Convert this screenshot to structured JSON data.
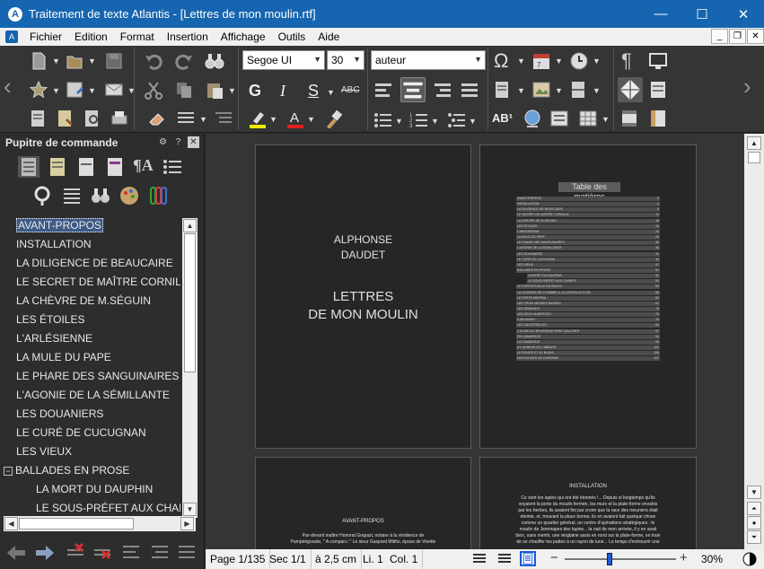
{
  "window": {
    "title": "Traitement de texte Atlantis - [Lettres de mon moulin.rtf]",
    "app_icon": "A",
    "minimize": "—",
    "maximize": "☐",
    "close": "✕"
  },
  "menu": {
    "items": [
      "Fichier",
      "Edition",
      "Format",
      "Insertion",
      "Affichage",
      "Outils",
      "Aide"
    ],
    "mdi_minimize": "_",
    "mdi_restore": "❐",
    "mdi_close": "✕"
  },
  "toolbar": {
    "font_name": "Segoe UI",
    "font_size": "30",
    "style_name": "auteur",
    "bold": "G",
    "italic": "I",
    "underline": "S",
    "strike": "ABC",
    "superscript_label": "AB¹"
  },
  "panel": {
    "title": "Pupitre de commande",
    "gear": "⚙",
    "help": "?",
    "close": "✕",
    "tree": [
      {
        "label": "AVANT-PROPOS",
        "selected": true,
        "indent": 0
      },
      {
        "label": "INSTALLATION",
        "indent": 0
      },
      {
        "label": "LA DILIGENCE DE BEAUCAIRE",
        "indent": 0
      },
      {
        "label": "LE SECRET DE MAÎTRE CORNILLE",
        "indent": 0
      },
      {
        "label": "LA CHÈVRE DE M.SÉGUIN",
        "indent": 0
      },
      {
        "label": "LES ÉTOILES",
        "indent": 0
      },
      {
        "label": "L'ARLÉSIENNE",
        "indent": 0
      },
      {
        "label": "LA MULE DU PAPE",
        "indent": 0
      },
      {
        "label": "LE PHARE DES SANGUINAIRES",
        "indent": 0
      },
      {
        "label": "L'AGONIE DE LA SÉMILLANTE",
        "indent": 0
      },
      {
        "label": "LES DOUANIERS",
        "indent": 0
      },
      {
        "label": "LE CURÉ DE CUCUGNAN",
        "indent": 0
      },
      {
        "label": "LES VIEUX",
        "indent": 0
      },
      {
        "label": "BALLADES EN PROSE",
        "indent": 0,
        "toggle": "−"
      },
      {
        "label": "LA MORT DU DAUPHIN",
        "indent": 1
      },
      {
        "label": "LE SOUS-PRÉFET AUX CHAMPS",
        "indent": 1
      }
    ]
  },
  "document": {
    "cover": {
      "author_line1": "ALPHONSE",
      "author_line2": "DAUDET",
      "title_line1": "LETTRES",
      "title_line2": "DE MON MOULIN"
    },
    "toc": {
      "title": "Table des matières",
      "entries": [
        {
          "t": "AVANT-PROPOS",
          "p": "3"
        },
        {
          "t": "INSTALLATION",
          "p": "4"
        },
        {
          "t": "LA DILIGENCE DE BEAUCAIRE",
          "p": "8"
        },
        {
          "t": "LE SECRET DE MAÎTRE CORNILLE",
          "p": "11"
        },
        {
          "t": "LA CHÈVRE DE M.SÉGUIN",
          "p": "15"
        },
        {
          "t": "LES ÉTOILES",
          "p": "19"
        },
        {
          "t": "L'ARLÉSIENNE",
          "p": "23"
        },
        {
          "t": "LA MULE DU PAPE",
          "p": "26"
        },
        {
          "t": "LE PHARE DES SANGUINAIRES",
          "p": "32"
        },
        {
          "t": "L'AGONIE DE LA SÉMILLANTE",
          "p": "36"
        },
        {
          "t": "LES DOUANIERS",
          "p": "41"
        },
        {
          "t": "LE CURÉ DE CUCUGNAN",
          "p": "44"
        },
        {
          "t": "LES VIEUX",
          "p": "47"
        },
        {
          "t": "BALLADES EN PROSE",
          "p": "51"
        },
        {
          "t": "LA MORT DU DAUPHIN",
          "p": "51",
          "sub": true
        },
        {
          "t": "LE SOUS-PRÉFET AUX CHAMPS",
          "p": "53",
          "sub": true
        },
        {
          "t": "LE PORTEFEUILLE DE BIXIOU",
          "p": "55"
        },
        {
          "t": "LA LÉGENDE DE L'HOMME À LA CERVELLE D'OR",
          "p": "59"
        },
        {
          "t": "LE POÈTE MISTRAL",
          "p": "62"
        },
        {
          "t": "LES TROIS MESSES BASSES",
          "p": "67"
        },
        {
          "t": "LES ORANGES",
          "p": "73"
        },
        {
          "t": "LES DEUX AUBERGES",
          "p": "75"
        },
        {
          "t": "À MILIANAH",
          "p": "78"
        },
        {
          "t": "LES SAUTERELLES",
          "p": "84"
        },
        {
          "t": "L'ÉLIXIR DU RÉVÉREND PÈRE GAUCHER",
          "p": "87"
        },
        {
          "t": "EN CAMARGUE",
          "p": "93"
        },
        {
          "t": "LA CAMARGUE",
          "p": "95"
        },
        {
          "t": "À L'ANNEXE DE L'ABBAYE",
          "p": "101"
        },
        {
          "t": "LE ROUGE ET LE BLANC",
          "p": "105"
        },
        {
          "t": "NOSTALGIES DE CASERNE",
          "p": "107"
        }
      ]
    },
    "avant_propos": {
      "heading": "AVANT-PROPOS",
      "line1": "Par-devant maître Honorat Grapazi, notaire à la résidence de",
      "line2": "Pampérigouste, \" A comparu :\" Le sieur Gaspard Mitifio, époux de Vivette"
    },
    "installation": {
      "heading": "INSTALLATION",
      "lines": [
        "Ce sont les lapins qui ont été étonnés !... Depuis si longtemps qu'ils",
        "voyaient la porte du moulin fermée, les murs et la plate-forme envahis",
        "par les herbes, ils avaient fini par croire que la race des meuniers était",
        "éteinte, et, trouvant la place bonne, ils en avaient fait quelque chose",
        "comme un quartier général, un centre d'opérations stratégiques : le",
        "moulin de Jemmapes des lapins... la nuit de mon arrivée, il y en avait",
        "bien, sans mentir, une vingtaine assis en rond sur la plate-forme, en train",
        "de se chauffer les pattes à un rayon de lune... Le temps d'entrouvrir une"
      ]
    }
  },
  "status": {
    "page": "Page 1/135",
    "section": "Sec 1/1",
    "position": "à 2,5 cm",
    "line": "Li. 1",
    "column": "Col. 1",
    "zoom": "30%",
    "zoom_fraction": 0.4,
    "zoom_minus": "−",
    "zoom_plus": "+"
  }
}
